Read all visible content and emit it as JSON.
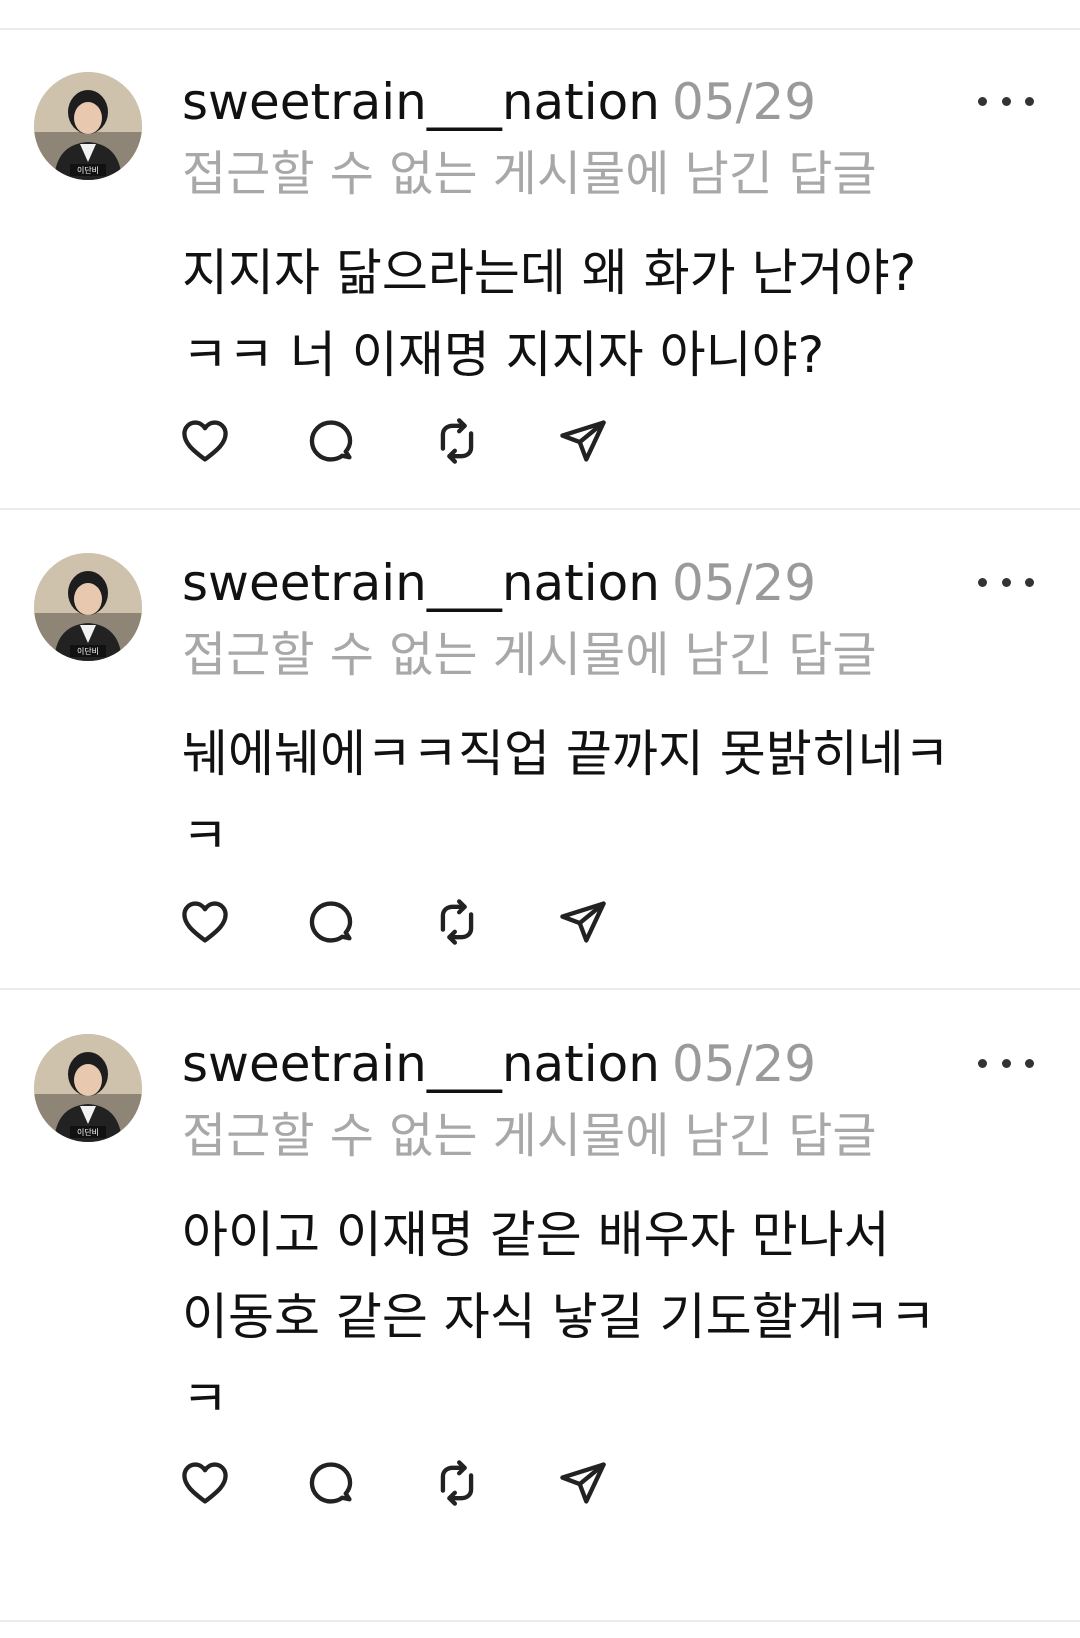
{
  "posts": [
    {
      "username": "sweetrain___nation",
      "date": "05/29",
      "context": "접근할 수 없는 게시물에 남긴 답글",
      "text": "지지자 닮으라는데 왜 화가 난거야?\nㅋㅋ 너 이재명 지지자 아니야?",
      "avatar_caption": "이단비"
    },
    {
      "username": "sweetrain___nation",
      "date": "05/29",
      "context": "접근할 수 없는 게시물에 남긴 답글",
      "text": "눼에눼에ㅋㅋ직업 끝까지 못밝히네ㅋ\nㅋ",
      "avatar_caption": "이단비"
    },
    {
      "username": "sweetrain___nation",
      "date": "05/29",
      "context": "접근할 수 없는 게시물에 남긴 답글",
      "text": "아이고 이재명 같은 배우자 만나서\n이동호 같은 자식 낳길 기도할게ㅋㅋ\nㅋ",
      "avatar_caption": "이단비"
    }
  ],
  "icons": {
    "more": "more-horizontal-icon",
    "like": "heart-icon",
    "reply": "comment-bubble-icon",
    "repost": "repost-icon",
    "share": "send-icon"
  },
  "colors": {
    "text": "#111111",
    "muted": "#a8a8a8",
    "divider": "#ececec"
  }
}
